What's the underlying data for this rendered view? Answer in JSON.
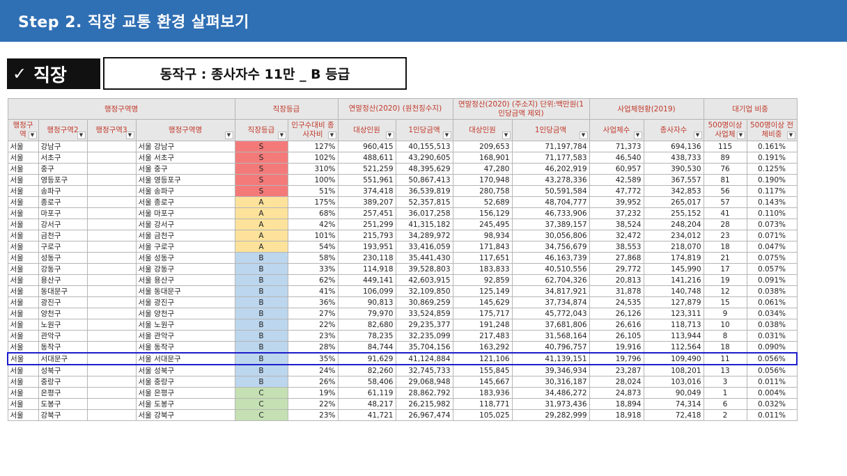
{
  "header": {
    "title": "Step 2. 직장 교통 환경 살펴보기"
  },
  "badge": {
    "check_icon": "✓",
    "label": "직장"
  },
  "info_box": {
    "text": "동작구 : 종사자수 11만 _ B 등급"
  },
  "table": {
    "group_headers": [
      "행정구역명",
      "직장등급",
      "연말정산(2020) (원천징수지)",
      "연말정산(2020) (주소지) 단위:백만원(1인당금액 제외)",
      "사업체현황(2019)",
      "대기업 비중"
    ],
    "columns": [
      "행정구역",
      "행정구역2",
      "행정구역3",
      "행정구역명",
      "직장등급",
      "인구수대비 종사자비",
      "대상인원",
      "1인당금액",
      "대상인원",
      "1인당금액",
      "사업체수",
      "종사자수",
      "500명이상 사업체",
      "500명이상 전체비중"
    ],
    "rows": [
      [
        "서울",
        "강남구",
        "",
        "서울 강남구",
        "S",
        "127%",
        "960,415",
        "40,155,513",
        "209,653",
        "71,197,784",
        "71,373",
        "694,136",
        "115",
        "0.161%"
      ],
      [
        "서울",
        "서초구",
        "",
        "서울 서초구",
        "S",
        "102%",
        "488,611",
        "43,290,605",
        "168,901",
        "71,177,583",
        "46,540",
        "438,733",
        "89",
        "0.191%"
      ],
      [
        "서울",
        "중구",
        "",
        "서울 중구",
        "S",
        "310%",
        "521,259",
        "48,395,629",
        "47,280",
        "46,202,919",
        "60,957",
        "390,530",
        "76",
        "0.125%"
      ],
      [
        "서울",
        "영등포구",
        "",
        "서울 영등포구",
        "S",
        "100%",
        "551,961",
        "50,867,413",
        "170,948",
        "43,278,336",
        "42,589",
        "367,557",
        "81",
        "0.190%"
      ],
      [
        "서울",
        "송파구",
        "",
        "서울 송파구",
        "S",
        "51%",
        "374,418",
        "36,539,819",
        "280,758",
        "50,591,584",
        "47,772",
        "342,853",
        "56",
        "0.117%"
      ],
      [
        "서울",
        "종로구",
        "",
        "서울 종로구",
        "A",
        "175%",
        "389,207",
        "52,357,815",
        "52,689",
        "48,704,777",
        "39,952",
        "265,017",
        "57",
        "0.143%"
      ],
      [
        "서울",
        "마포구",
        "",
        "서울 마포구",
        "A",
        "68%",
        "257,451",
        "36,017,258",
        "156,129",
        "46,733,906",
        "37,232",
        "255,152",
        "41",
        "0.110%"
      ],
      [
        "서울",
        "강서구",
        "",
        "서울 강서구",
        "A",
        "42%",
        "251,299",
        "41,315,182",
        "245,495",
        "37,389,157",
        "38,524",
        "248,204",
        "28",
        "0.073%"
      ],
      [
        "서울",
        "금천구",
        "",
        "서울 금천구",
        "A",
        "101%",
        "215,793",
        "34,289,972",
        "98,934",
        "30,056,806",
        "32,472",
        "234,012",
        "23",
        "0.071%"
      ],
      [
        "서울",
        "구로구",
        "",
        "서울 구로구",
        "A",
        "54%",
        "193,951",
        "33,416,059",
        "171,843",
        "34,756,679",
        "38,553",
        "218,070",
        "18",
        "0.047%"
      ],
      [
        "서울",
        "성동구",
        "",
        "서울 성동구",
        "B",
        "58%",
        "230,118",
        "35,441,430",
        "117,651",
        "46,163,739",
        "27,868",
        "174,819",
        "21",
        "0.075%"
      ],
      [
        "서울",
        "강동구",
        "",
        "서울 강동구",
        "B",
        "33%",
        "114,918",
        "39,528,803",
        "183,833",
        "40,510,556",
        "29,772",
        "145,990",
        "17",
        "0.057%"
      ],
      [
        "서울",
        "용산구",
        "",
        "서울 용산구",
        "B",
        "62%",
        "449,141",
        "42,603,915",
        "92,859",
        "62,704,326",
        "20,813",
        "141,216",
        "19",
        "0.091%"
      ],
      [
        "서울",
        "동대문구",
        "",
        "서울 동대문구",
        "B",
        "41%",
        "106,099",
        "32,109,850",
        "125,149",
        "34,817,921",
        "31,878",
        "140,748",
        "12",
        "0.038%"
      ],
      [
        "서울",
        "광진구",
        "",
        "서울 광진구",
        "B",
        "36%",
        "90,813",
        "30,869,259",
        "145,629",
        "37,734,874",
        "24,535",
        "127,879",
        "15",
        "0.061%"
      ],
      [
        "서울",
        "양천구",
        "",
        "서울 양천구",
        "B",
        "27%",
        "79,970",
        "33,524,859",
        "175,717",
        "45,772,043",
        "26,126",
        "123,311",
        "9",
        "0.034%"
      ],
      [
        "서울",
        "노원구",
        "",
        "서울 노원구",
        "B",
        "22%",
        "82,680",
        "29,235,377",
        "191,248",
        "37,681,806",
        "26,616",
        "118,713",
        "10",
        "0.038%"
      ],
      [
        "서울",
        "관악구",
        "",
        "서울 관악구",
        "B",
        "23%",
        "78,235",
        "32,235,099",
        "217,483",
        "31,568,164",
        "26,105",
        "113,944",
        "8",
        "0.031%"
      ],
      [
        "서울",
        "동작구",
        "",
        "서울 동작구",
        "B",
        "28%",
        "84,744",
        "35,704,156",
        "163,292",
        "40,796,757",
        "19,916",
        "112,564",
        "18",
        "0.090%"
      ],
      [
        "서울",
        "서대문구",
        "",
        "서울 서대문구",
        "B",
        "35%",
        "91,629",
        "41,124,884",
        "121,106",
        "41,139,151",
        "19,796",
        "109,490",
        "11",
        "0.056%"
      ],
      [
        "서울",
        "성북구",
        "",
        "서울 성북구",
        "B",
        "24%",
        "82,260",
        "32,745,733",
        "155,845",
        "39,346,934",
        "23,287",
        "108,201",
        "13",
        "0.056%"
      ],
      [
        "서울",
        "중랑구",
        "",
        "서울 중랑구",
        "B",
        "26%",
        "58,406",
        "29,068,948",
        "145,667",
        "30,316,187",
        "28,024",
        "103,016",
        "3",
        "0.011%"
      ],
      [
        "서울",
        "은평구",
        "",
        "서울 은평구",
        "C",
        "19%",
        "61,119",
        "28,862,792",
        "183,936",
        "34,486,272",
        "24,873",
        "90,049",
        "1",
        "0.004%"
      ],
      [
        "서울",
        "도봉구",
        "",
        "서울 도봉구",
        "C",
        "22%",
        "48,217",
        "26,215,982",
        "118,771",
        "31,973,436",
        "18,894",
        "74,314",
        "6",
        "0.032%"
      ],
      [
        "서울",
        "강북구",
        "",
        "서울 강북구",
        "C",
        "23%",
        "41,721",
        "26,967,474",
        "105,025",
        "29,282,999",
        "18,918",
        "72,418",
        "2",
        "0.011%"
      ]
    ],
    "highlight_row_index": 19,
    "grade_colors": {
      "S": "#f47a7a",
      "A": "#fce29a",
      "B": "#bcd6ee",
      "C": "#c5e0b3"
    },
    "highlight_color": "#1c1ccc"
  }
}
